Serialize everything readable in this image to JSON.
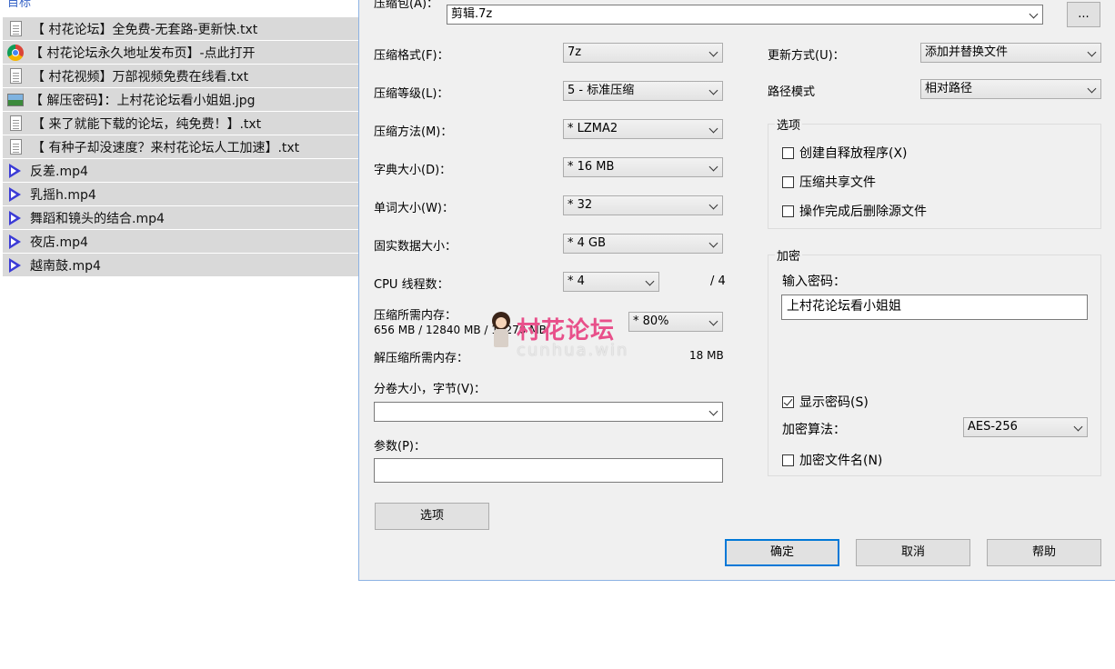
{
  "top_link": "目标",
  "files": [
    {
      "icon": "text-file-icon",
      "name": "【 村花论坛】全免费-无套路-更新快.txt"
    },
    {
      "icon": "chrome-icon",
      "name": "【 村花论坛永久地址发布页】-点此打开"
    },
    {
      "icon": "text-file-icon",
      "name": "【 村花视频】万部视频免费在线看.txt"
    },
    {
      "icon": "image-file-icon",
      "name": "【 解压密码】：上村花论坛看小姐姐.jpg"
    },
    {
      "icon": "text-file-icon",
      "name": "【 来了就能下载的论坛，纯免费！】.txt"
    },
    {
      "icon": "text-file-icon",
      "name": "【 有种子却没速度？来村花论坛人工加速】.txt"
    },
    {
      "icon": "video-file-icon",
      "name": "反差.mp4"
    },
    {
      "icon": "video-file-icon",
      "name": "乳摇h.mp4"
    },
    {
      "icon": "video-file-icon",
      "name": "舞蹈和镜头的结合.mp4"
    },
    {
      "icon": "video-file-icon",
      "name": "夜店.mp4"
    },
    {
      "icon": "video-file-icon",
      "name": "越南鼓.mp4"
    }
  ],
  "dialog": {
    "archive_label": "压缩包(A)：",
    "archive_value": "剪辑.7z",
    "browse_label": "...",
    "left": {
      "format_label": "压缩格式(F)：",
      "format_value": "7z",
      "level_label": "压缩等级(L)：",
      "level_value": "5 - 标准压缩",
      "method_label": "压缩方法(M)：",
      "method_value": "* LZMA2",
      "dict_label": "字典大小(D)：",
      "dict_value": "* 16 MB",
      "word_label": "单词大小(W)：",
      "word_value": "* 32",
      "solid_label": "固实数据大小：",
      "solid_value": "* 4 GB",
      "threads_label": "CPU 线程数：",
      "threads_value": "* 4",
      "threads_max": "/ 4",
      "mem_label": "压缩所需内存：",
      "mem_value": "656 MB / 12840 MB / 10270 MB",
      "mem_pct": "* 80%",
      "decomp_label": "解压缩所需内存：",
      "decomp_value": "18 MB",
      "volume_label": "分卷大小，字节(V)：",
      "volume_value": "",
      "params_label": "参数(P)：",
      "params_value": "",
      "options_button": "选项"
    },
    "right": {
      "update_label": "更新方式(U)：",
      "update_value": "添加并替换文件",
      "path_label": "路径模式",
      "path_value": "相对路径",
      "options_group": "选项",
      "opt_sfx": "创建自释放程序(X)",
      "opt_shared": "压缩共享文件",
      "opt_delete": "操作完成后删除源文件",
      "encrypt_group": "加密",
      "password_label": "输入密码：",
      "password_value": "上村花论坛看小姐姐",
      "show_password": "显示密码(S)",
      "algo_label": "加密算法：",
      "algo_value": "AES-256",
      "encrypt_names": "加密文件名(N)"
    },
    "buttons": {
      "ok": "确定",
      "cancel": "取消",
      "help": "帮助"
    }
  },
  "watermark": {
    "cn": "村花论坛",
    "en": "cunhua.win"
  },
  "colors": {
    "accent": "#0078d7",
    "list_bg": "#d9d9d9",
    "dialog_bg": "#f0f0f0",
    "watermark": "#e8508a"
  }
}
